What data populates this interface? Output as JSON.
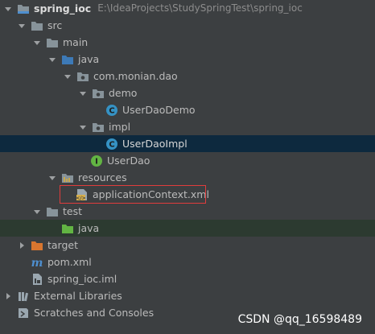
{
  "tree": {
    "project_name": "spring_ioc",
    "project_path": "E:\\IdeaProjects\\StudySpringTest\\spring_ioc",
    "src": "src",
    "main": "main",
    "java": "java",
    "package": "com.monian.dao",
    "demo": "demo",
    "user_dao_demo": "UserDaoDemo",
    "impl": "impl",
    "user_dao_impl": "UserDaoImpl",
    "user_dao": "UserDao",
    "resources": "resources",
    "app_context": "applicationContext.xml",
    "test": "test",
    "test_java": "java",
    "target": "target",
    "pom": "pom.xml",
    "iml": "spring_ioc.iml",
    "external_libraries": "External Libraries",
    "scratches": "Scratches and Consoles"
  },
  "watermark": "CSDN @qq_16598489",
  "colors": {
    "background": "#3c3f41",
    "selection": "#0d293e",
    "folder_blue": "#87939a",
    "source_folder": "#3d7ab7",
    "class_icon": "#3592c4",
    "interface_icon": "#62b543",
    "target_folder": "#d8762f",
    "highlight_border": "#e03c3c"
  }
}
